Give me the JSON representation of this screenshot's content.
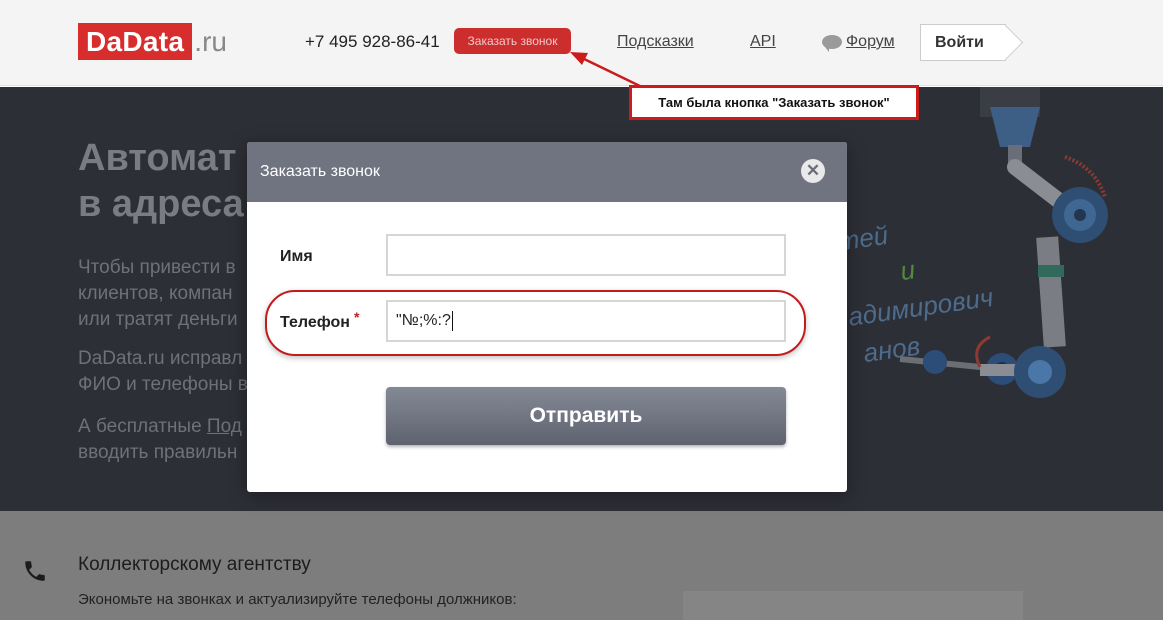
{
  "header": {
    "logo_main": "DaData",
    "logo_suffix": ".ru",
    "phone": "+7 495 928-86-41",
    "callback_label": "Заказать звонок",
    "nav": {
      "hints": "Подсказки",
      "api": "API",
      "forum": "Форум"
    },
    "login_label": "Войти"
  },
  "annotation": {
    "text": "Там была кнопка \"Заказать звонок\""
  },
  "hero": {
    "title_line1": "Автомат",
    "title_line2": "в адреса",
    "p1_line1": "Чтобы привести в",
    "p1_line2": "клиентов, компан",
    "p1_line3": "или тратят деньги",
    "p2_line1": "DaData.ru исправл",
    "p2_line2": "ФИО и телефоны в",
    "p3_line1_prefix": "А бесплатные ",
    "p3_line1_link": "Под",
    "p3_line2": "вводить правильн",
    "signature_line1": "тей",
    "signature_line2": "и",
    "signature_line3": "адимирович",
    "signature_line4": "анов"
  },
  "bottom": {
    "title": "Коллекторскому агентству",
    "text": "Экономьте на звонках и актуализируйте телефоны должников:"
  },
  "modal": {
    "title": "Заказать звонок",
    "close_symbol": "✕",
    "name_label": "Имя",
    "name_value": "",
    "phone_label": "Телефон",
    "required_mark": "*",
    "phone_value": "\"№;%:?",
    "submit_label": "Отправить"
  },
  "colors": {
    "brand_red": "#d72d2d",
    "modal_header": "#6f7480",
    "annotation_border": "#cc1b1b"
  }
}
